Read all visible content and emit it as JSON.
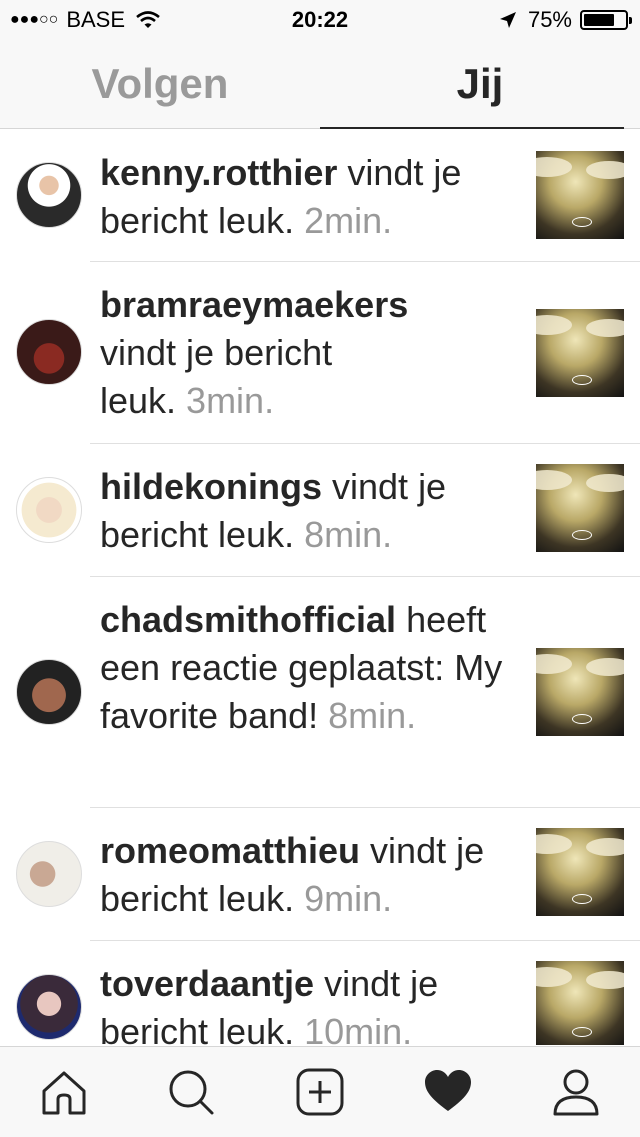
{
  "status_bar": {
    "signal": "●●●○○",
    "carrier": "BASE",
    "time": "20:22",
    "battery_percent": "75%",
    "battery_level": 0.75
  },
  "tabs": [
    {
      "label": "Volgen",
      "active": false
    },
    {
      "label": "Jij",
      "active": true
    }
  ],
  "notifications": [
    {
      "username": "kenny.rotthier",
      "text": " vindt je bericht leuk. ",
      "time": "2min."
    },
    {
      "username": "bramraeymaekers",
      "text": " vindt je bericht leuk. ",
      "time": "3min."
    },
    {
      "username": "hildekonings",
      "text": " vindt je bericht leuk. ",
      "time": "8min."
    },
    {
      "username": "chadsmithofficial",
      "text": " heeft een reactie geplaatst: My favorite band! ",
      "time": "8min."
    },
    {
      "username": "romeomatthieu",
      "text": " vindt je bericht leuk. ",
      "time": "9min."
    },
    {
      "username": "toverdaantje",
      "text": " vindt je bericht leuk. ",
      "time": "10min."
    }
  ],
  "tabbar": {
    "items": [
      "home-icon",
      "search-icon",
      "add-post-icon",
      "heart-icon",
      "profile-icon"
    ],
    "active": "heart-icon"
  }
}
